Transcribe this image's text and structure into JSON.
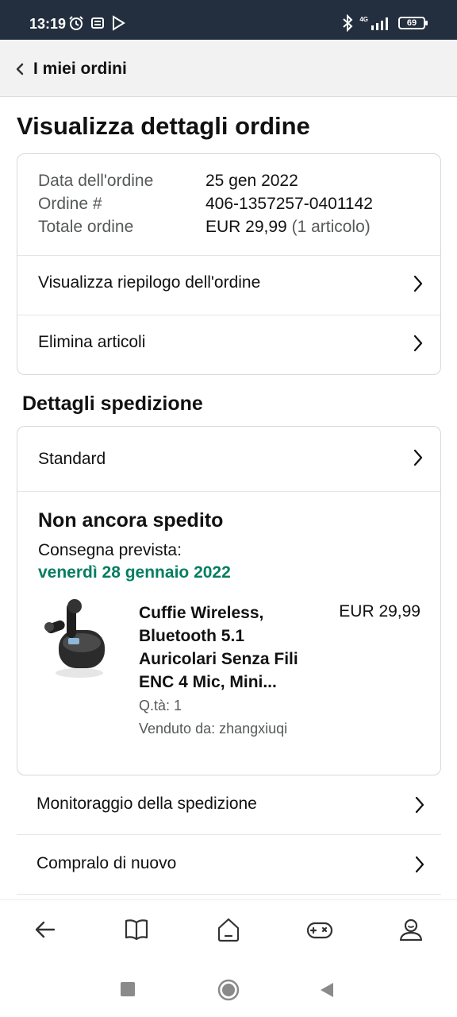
{
  "status_bar": {
    "time": "13:19",
    "battery": "69",
    "network": "4G"
  },
  "nav": {
    "title": "I miei ordini"
  },
  "page": {
    "title": "Visualizza dettagli ordine"
  },
  "order": {
    "date_label": "Data dell'ordine",
    "date_value": "25 gen 2022",
    "number_label": "Ordine #",
    "number_value": "406-1357257-0401142",
    "total_label": "Totale ordine",
    "total_value": "EUR 29,99",
    "total_items": "(1 articolo)",
    "summary_link": "Visualizza riepilogo dell'ordine",
    "delete_link": "Elimina articoli"
  },
  "shipping": {
    "section_title": "Dettagli spedizione",
    "method": "Standard",
    "status": "Non ancora spedito",
    "delivery_label": "Consegna prevista:",
    "delivery_date": "venerdì 28 gennaio 2022"
  },
  "product": {
    "title_lines": [
      "Cuffie Wireless,",
      "Bluetooth 5.1",
      "Auricolari Senza Fili",
      "ENC 4 Mic, Mini..."
    ],
    "price": "EUR 29,99",
    "quantity": "Q.tà: 1",
    "seller": "Venduto da: zhangxiuqi"
  },
  "actions": {
    "track": "Monitoraggio della spedizione",
    "buy_again": "Compralo di nuovo"
  },
  "bottom_tabs": [
    "back-arrow-icon",
    "book-icon",
    "home-icon",
    "gamepad-icon",
    "account-icon"
  ],
  "colors": {
    "status_bar_bg": "#232f3e",
    "delivery_green": "#067d62",
    "nav_bg": "#f2f2f2"
  }
}
